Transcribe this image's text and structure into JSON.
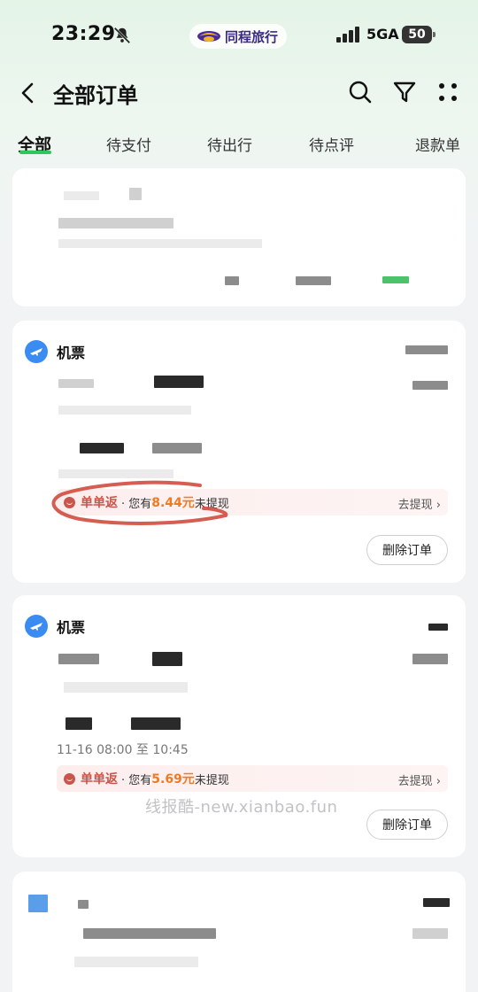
{
  "status_bar": {
    "time": "23:29",
    "brand_name": "同程旅行",
    "network": "5GA",
    "battery": "50"
  },
  "header": {
    "title": "全部订单"
  },
  "tabs": [
    {
      "label": "全部",
      "active": true
    },
    {
      "label": "待支付",
      "active": false
    },
    {
      "label": "待出行",
      "active": false
    },
    {
      "label": "待点评",
      "active": false
    },
    {
      "label": "退款单",
      "active": false
    }
  ],
  "orders": [
    {
      "type": "机票",
      "cashback": {
        "name": "单单返",
        "prefix": "· 您有",
        "amount": "8.44元",
        "suffix": "未提现",
        "action": "去提现"
      },
      "delete_label": "删除订单"
    },
    {
      "type": "机票",
      "time_range": "11-16 08:00 至 10:45",
      "cashback": {
        "name": "单单返",
        "prefix": "· 您有",
        "amount": "5.69元",
        "suffix": "未提现",
        "action": "去提现"
      },
      "delete_label": "删除订单"
    }
  ],
  "watermark": "线报酷-new.xianbao.fun",
  "colors": {
    "accent_green": "#2dc85a",
    "cashback_red": "#c9564a",
    "amount_orange": "#f07a22",
    "brand_purple": "#3b2a86",
    "plane_blue": "#3b8cf2"
  }
}
